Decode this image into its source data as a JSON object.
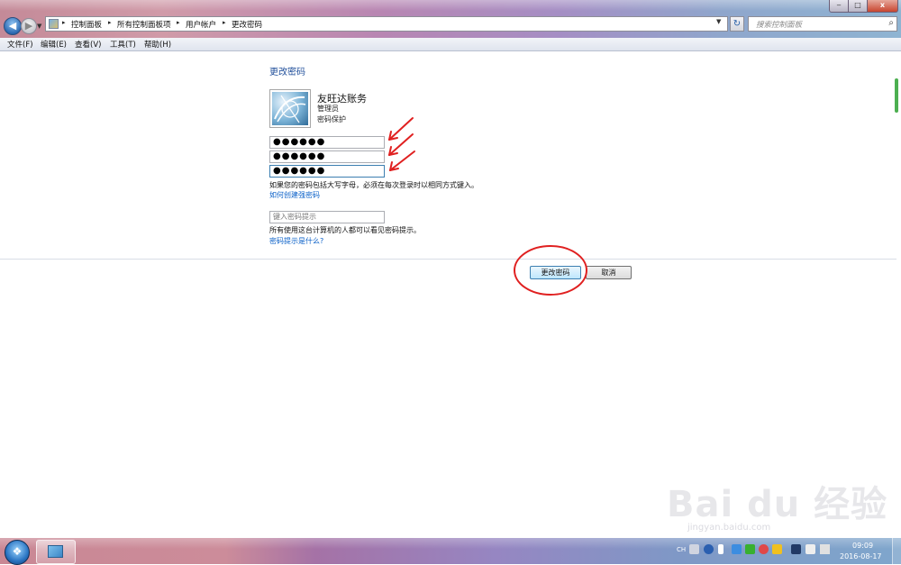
{
  "window": {
    "min_glyph": "‒",
    "max_glyph": "□",
    "close_glyph": "x"
  },
  "address": {
    "crumbs": [
      "控制面板",
      "所有控制面板项",
      "用户帐户",
      "更改密码"
    ],
    "separator": "▸",
    "search_placeholder": "搜索控制面板"
  },
  "menu": [
    "文件(F)",
    "编辑(E)",
    "查看(V)",
    "工具(T)",
    "帮助(H)"
  ],
  "page": {
    "heading": "更改密码",
    "user_name": "友旺达账务",
    "user_role": "管理员",
    "user_protect": "密码保护",
    "current_password": "●●●●●●",
    "new_password": "●●●●●●",
    "confirm_password": "●●●●●●",
    "caps_note": "如果您的密码包括大写字母，必须在每次登录时以相同方式键入。",
    "strong_pw_link": "如何创建强密码",
    "hint_placeholder": "键入密码提示",
    "hint_note": "所有使用这台计算机的人都可以看见密码提示。",
    "hint_link": "密码提示是什么?",
    "change_button": "更改密码",
    "cancel_button": "取消"
  },
  "taskbar": {
    "language": "CH",
    "time": "09:09",
    "date": "2016-08-17"
  },
  "watermark": {
    "brand": "Bai du 经验",
    "url": "jingyan.baidu.com"
  },
  "annotations": {
    "arrow_color": "#e02020",
    "circle_color": "#e02020"
  }
}
